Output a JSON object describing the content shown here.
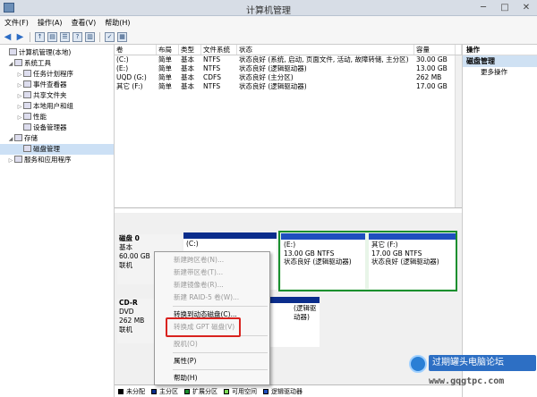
{
  "window": {
    "title": "计算机管理",
    "min": "─",
    "max": "□",
    "close": "✕"
  },
  "menu": [
    "文件(F)",
    "操作(A)",
    "查看(V)",
    "帮助(H)"
  ],
  "tree": [
    {
      "label": "计算机管理(本地)",
      "level": 0,
      "ex": "",
      "sel": false
    },
    {
      "label": "系统工具",
      "level": 1,
      "ex": "◢",
      "sel": false
    },
    {
      "label": "任务计划程序",
      "level": 2,
      "ex": "▷",
      "sel": false
    },
    {
      "label": "事件查看器",
      "level": 2,
      "ex": "▷",
      "sel": false
    },
    {
      "label": "共享文件夹",
      "level": 2,
      "ex": "▷",
      "sel": false
    },
    {
      "label": "本地用户和组",
      "level": 2,
      "ex": "▷",
      "sel": false
    },
    {
      "label": "性能",
      "level": 2,
      "ex": "▷",
      "sel": false
    },
    {
      "label": "设备管理器",
      "level": 2,
      "ex": "",
      "sel": false
    },
    {
      "label": "存储",
      "level": 1,
      "ex": "◢",
      "sel": false
    },
    {
      "label": "磁盘管理",
      "level": 2,
      "ex": "",
      "sel": true
    },
    {
      "label": "服务和应用程序",
      "level": 1,
      "ex": "▷",
      "sel": false
    }
  ],
  "volumes": {
    "headers": [
      "卷",
      "布局",
      "类型",
      "文件系统",
      "状态",
      "容量",
      ""
    ],
    "rows": [
      [
        "(C:)",
        "简单",
        "基本",
        "NTFS",
        "状态良好 (系统, 启动, 页面文件, 活动, 故障转储, 主分区)",
        "30.00 GB",
        ""
      ],
      [
        "(E:)",
        "简单",
        "基本",
        "NTFS",
        "状态良好 (逻辑驱动器)",
        "13.00 GB",
        ""
      ],
      [
        "UQD (G:)",
        "简单",
        "基本",
        "CDFS",
        "状态良好 (主分区)",
        "262 MB",
        ""
      ],
      [
        "其它 (F:)",
        "简单",
        "基本",
        "NTFS",
        "状态良好 (逻辑驱动器)",
        "17.00 GB",
        ""
      ]
    ]
  },
  "disk0": {
    "name": "磁盘 0",
    "type": "基本",
    "size": "60.00 GB",
    "status": "联机"
  },
  "cdrom": {
    "name": "CD-R",
    "type": "DVD",
    "size": "262 MB",
    "status": "联机"
  },
  "partitions": {
    "c": {
      "name": "(C:)",
      "detail": "",
      "status": ""
    },
    "e": {
      "name": "(E:)",
      "detail": "13.00 GB NTFS",
      "status": "状态良好 (逻辑驱动器)"
    },
    "f": {
      "name": "其它 (F:)",
      "detail": "17.00 GB NTFS",
      "status": "状态良好 (逻辑驱动器)"
    },
    "cd_status": "(逻辑驱动器)"
  },
  "legend": [
    {
      "label": "未分配",
      "color": "#000000"
    },
    {
      "label": "主分区",
      "color": "#0b2d8c"
    },
    {
      "label": "扩展分区",
      "color": "#1a8f2e"
    },
    {
      "label": "可用空间",
      "color": "#7ed957"
    },
    {
      "label": "逻辑驱动器",
      "color": "#1f4fbf"
    }
  ],
  "actions": {
    "header": "操作",
    "selected": "磁盘管理",
    "more": "更多操作"
  },
  "context_menu": [
    {
      "label": "新建跨区卷(N)...",
      "disabled": true
    },
    {
      "label": "新建带区卷(T)...",
      "disabled": true
    },
    {
      "label": "新建镜像卷(R)...",
      "disabled": true
    },
    {
      "label": "新建 RAID-5 卷(W)...",
      "disabled": true
    },
    {
      "sep": true
    },
    {
      "label": "转换到动态磁盘(C)...",
      "disabled": false
    },
    {
      "label": "转换成 GPT 磁盘(V)",
      "disabled": true
    },
    {
      "sep": true
    },
    {
      "label": "脱机(O)",
      "disabled": true
    },
    {
      "sep": true
    },
    {
      "label": "属性(P)",
      "disabled": false
    },
    {
      "sep": true
    },
    {
      "label": "帮助(H)",
      "disabled": false
    }
  ],
  "watermark": {
    "line1": "过期罐头电脑论坛",
    "line2": "www.gqgtpc.com"
  },
  "colors": {
    "selection": "#cce0f5",
    "primary_partition": "#0b2d8c",
    "extended_border": "#1a8f2e",
    "highlight_box": "#d9231f"
  }
}
